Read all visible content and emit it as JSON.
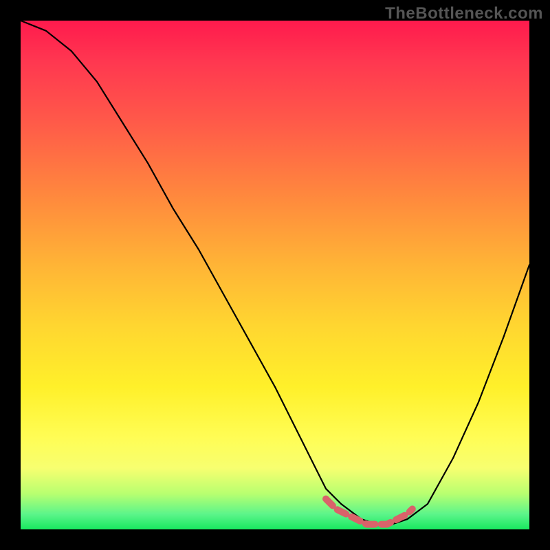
{
  "watermark": "TheBottleneck.com",
  "chart_data": {
    "type": "line",
    "title": "",
    "xlabel": "",
    "ylabel": "",
    "xlim": [
      0,
      100
    ],
    "ylim": [
      0,
      100
    ],
    "series": [
      {
        "name": "bottleneck-curve",
        "x": [
          0,
          5,
          10,
          15,
          20,
          25,
          30,
          35,
          40,
          45,
          50,
          55,
          58,
          60,
          63,
          67,
          70,
          73,
          76,
          80,
          85,
          90,
          95,
          100
        ],
        "values": [
          100,
          98,
          94,
          88,
          80,
          72,
          63,
          55,
          46,
          37,
          28,
          18,
          12,
          8,
          5,
          2,
          1,
          1,
          2,
          5,
          14,
          25,
          38,
          52
        ]
      }
    ],
    "highlight": {
      "name": "optimal-zone",
      "x": [
        60,
        62,
        64,
        66,
        68,
        70,
        72,
        74,
        76,
        77
      ],
      "values": [
        6,
        4,
        3,
        2,
        1,
        1,
        1,
        2,
        3,
        4
      ]
    },
    "colors": {
      "curve": "#000000",
      "highlight": "#d9626a",
      "gradient_top": "#ff1a4d",
      "gradient_bottom": "#18e860"
    }
  }
}
